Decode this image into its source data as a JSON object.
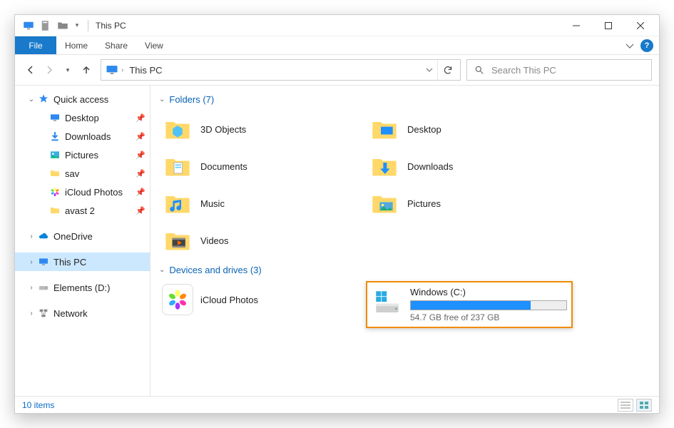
{
  "window": {
    "title": "This PC"
  },
  "ribbon": {
    "file": "File",
    "tabs": [
      "Home",
      "Share",
      "View"
    ]
  },
  "address": {
    "location": "This PC",
    "search_placeholder": "Search This PC"
  },
  "tree": {
    "quick_access": {
      "label": "Quick access",
      "expanded": true
    },
    "qa_items": [
      {
        "label": "Desktop",
        "icon": "desktop",
        "pinned": true
      },
      {
        "label": "Downloads",
        "icon": "downloads",
        "pinned": true
      },
      {
        "label": "Pictures",
        "icon": "pictures",
        "pinned": true
      },
      {
        "label": "sav",
        "icon": "folder",
        "pinned": true
      },
      {
        "label": "iCloud Photos",
        "icon": "icloud-photos",
        "pinned": true
      },
      {
        "label": "avast 2",
        "icon": "folder",
        "pinned": true
      }
    ],
    "onedrive": {
      "label": "OneDrive"
    },
    "thispc": {
      "label": "This PC",
      "selected": true
    },
    "elements": {
      "label": "Elements (D:)"
    },
    "network": {
      "label": "Network"
    }
  },
  "groups": {
    "folders": {
      "title": "Folders (7)",
      "items": [
        {
          "label": "3D Objects",
          "icon": "3dobjects"
        },
        {
          "label": "Desktop",
          "icon": "desktop-folder"
        },
        {
          "label": "Documents",
          "icon": "documents"
        },
        {
          "label": "Downloads",
          "icon": "downloads-folder"
        },
        {
          "label": "Music",
          "icon": "music"
        },
        {
          "label": "Pictures",
          "icon": "pictures-folder"
        },
        {
          "label": "Videos",
          "icon": "videos"
        }
      ]
    },
    "drives": {
      "title": "Devices and drives (3)",
      "items": [
        {
          "type": "app",
          "label": "iCloud Photos",
          "icon": "icloud-photos-app"
        },
        {
          "type": "drive",
          "label": "Windows (C:)",
          "free_text": "54.7 GB free of 237 GB",
          "free_gb": 54.7,
          "total_gb": 237,
          "used_pct": 77,
          "highlighted": true
        }
      ]
    }
  },
  "status": {
    "count_text": "10 items"
  }
}
